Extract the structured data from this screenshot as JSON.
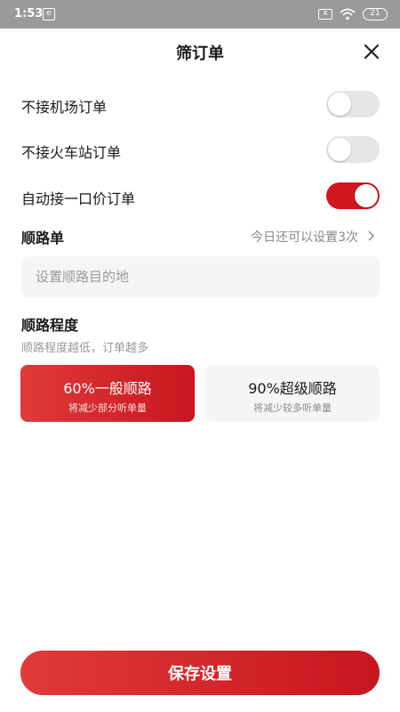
{
  "status_bar": {
    "time": "1:53",
    "app_icon_glyph": "e",
    "sim_glyph": "x",
    "battery": "21"
  },
  "header": {
    "title": "筛订单"
  },
  "toggles": [
    {
      "label": "不接机场订单",
      "on": false
    },
    {
      "label": "不接火车站订单",
      "on": false
    },
    {
      "label": "自动接一口价订单",
      "on": true
    }
  ],
  "route": {
    "title": "顺路单",
    "quota_text": "今日还可以设置3次",
    "input_placeholder": "设置顺路目的地"
  },
  "degree": {
    "title": "顺路程度",
    "subtitle": "顺路程度越低，订单越多",
    "options": [
      {
        "title": "60%一般顺路",
        "desc": "将减少部分听单量",
        "selected": true
      },
      {
        "title": "90%超级顺路",
        "desc": "将减少较多听单量",
        "selected": false
      }
    ]
  },
  "footer": {
    "save_label": "保存设置"
  },
  "colors": {
    "accent": "#d0161e",
    "switch_off": "#e6e6e6"
  }
}
